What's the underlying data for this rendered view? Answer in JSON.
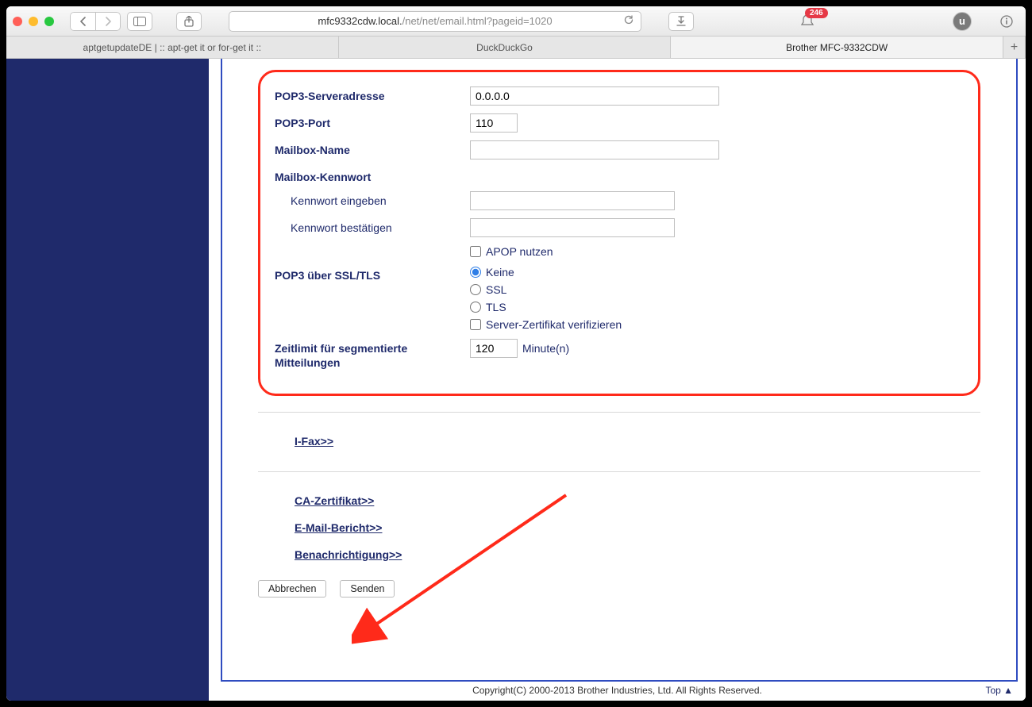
{
  "browser": {
    "url_host": "mfc9332cdw.local.",
    "url_path": "/net/net/email.html?pageid=1020",
    "badge_count": "246"
  },
  "tabs": [
    "aptgetupdateDE | :: apt-get it or for-get it ::",
    "DuckDuckGo",
    "Brother MFC-9332CDW"
  ],
  "form": {
    "pop3_server_label": "POP3-Serveradresse",
    "pop3_server_value": "0.0.0.0",
    "pop3_port_label": "POP3-Port",
    "pop3_port_value": "110",
    "mailbox_name_label": "Mailbox-Name",
    "mailbox_name_value": "",
    "mailbox_pw_label": "Mailbox-Kennwort",
    "pw_enter_label": "Kennwort eingeben",
    "pw_confirm_label": "Kennwort bestätigen",
    "apop_label": "APOP nutzen",
    "ssl_section_label": "POP3 über SSL/TLS",
    "ssl_options": {
      "none": "Keine",
      "ssl": "SSL",
      "tls": "TLS"
    },
    "verify_cert_label": "Server-Zertifikat verifizieren",
    "timeout_label": "Zeitlimit für segmentierte Mitteilungen",
    "timeout_value": "120",
    "timeout_unit": "Minute(n)"
  },
  "links": {
    "ifax": "I-Fax>>",
    "cacert": "CA-Zertifikat>>",
    "email_report": "E-Mail-Bericht>>",
    "notification": "Benachrichtigung>>"
  },
  "buttons": {
    "cancel": "Abbrechen",
    "submit": "Senden"
  },
  "footer": {
    "copyright": "Copyright(C) 2000-2013 Brother Industries, Ltd. All Rights Reserved.",
    "top": "Top ▲"
  }
}
